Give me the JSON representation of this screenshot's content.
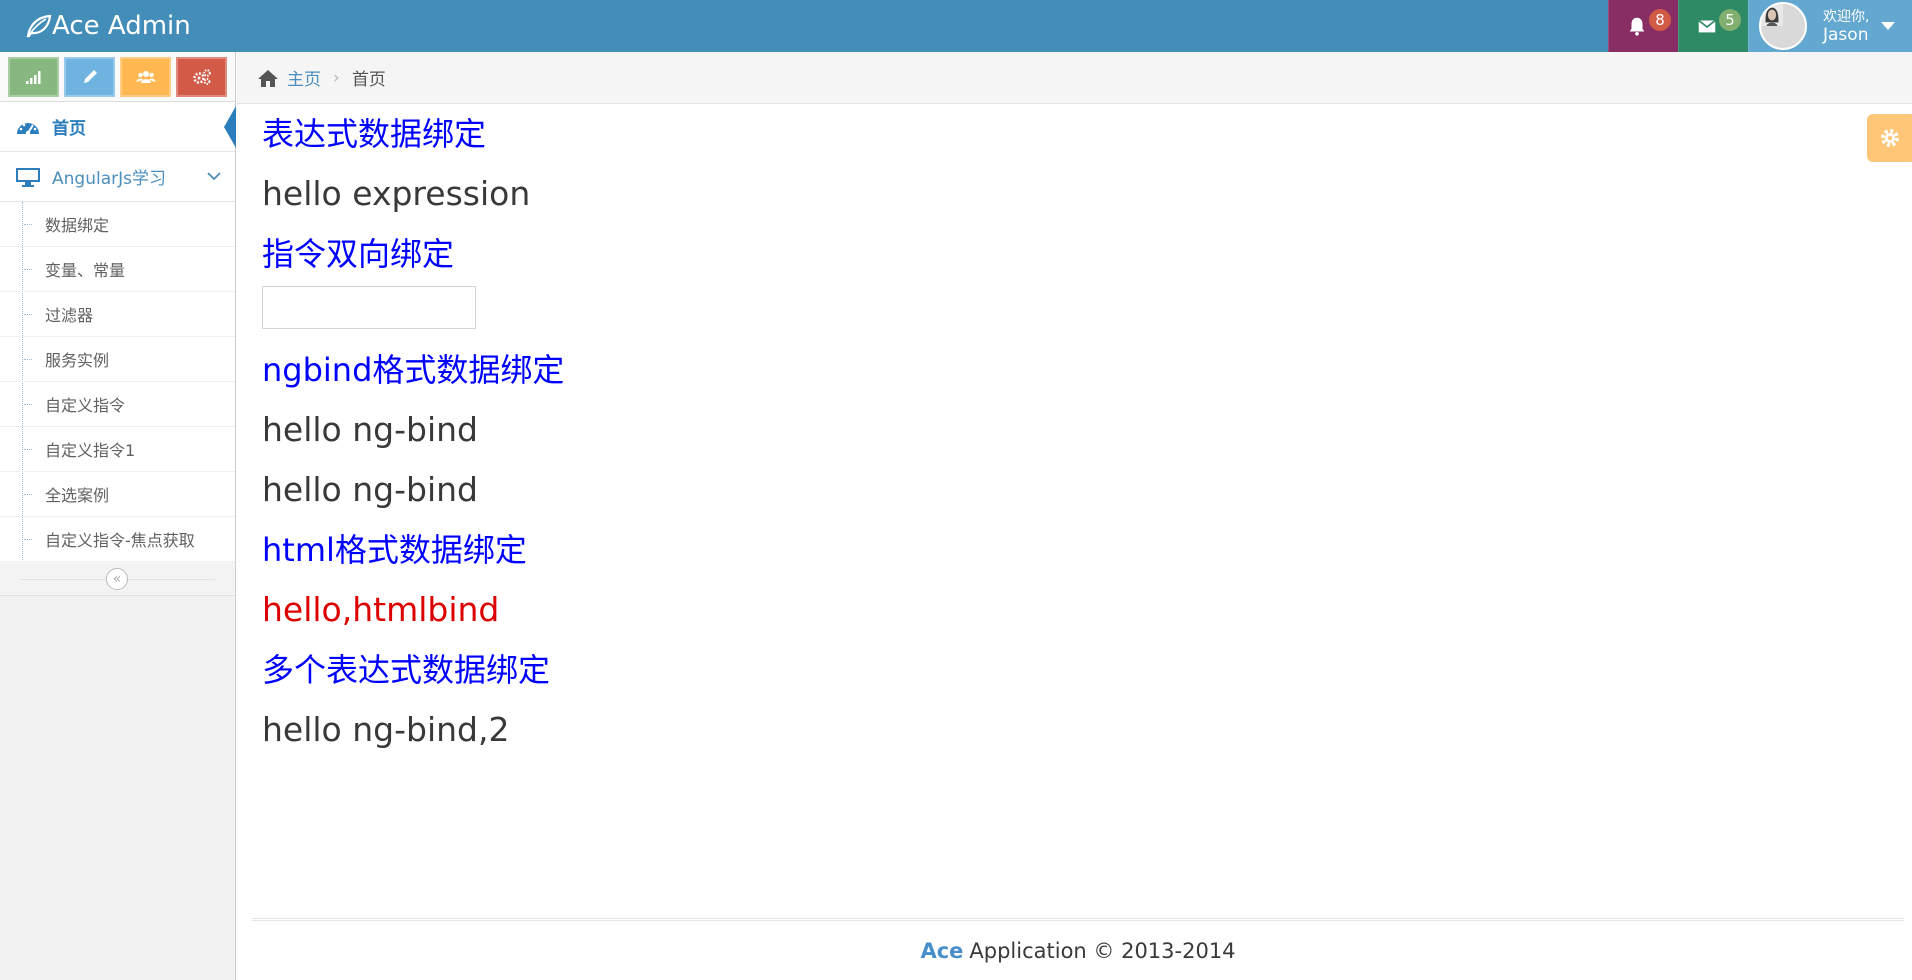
{
  "navbar": {
    "brand": "Ace Admin",
    "brand_icon": "leaf-icon",
    "notifications_count": "8",
    "messages_count": "5",
    "user": {
      "welcome": "欢迎你,",
      "name": "Jason"
    }
  },
  "sidebar": {
    "shortcuts": [
      {
        "icon": "signal-icon",
        "color": "#87b87f"
      },
      {
        "icon": "pencil-icon",
        "color": "#6fb3e0"
      },
      {
        "icon": "group-icon",
        "color": "#ffb752"
      },
      {
        "icon": "cogs-icon",
        "color": "#d15b47"
      }
    ],
    "items": [
      {
        "label": "首页",
        "icon": "dashboard-icon",
        "active": true
      },
      {
        "label": "AngularJs学习",
        "icon": "desktop-icon",
        "open": true
      }
    ],
    "subitems": [
      "数据绑定",
      "变量、常量",
      "过滤器",
      "服务实例",
      "自定义指令",
      "自定义指令1",
      "全选案例",
      "自定义指令-焦点获取"
    ]
  },
  "breadcrumbs": {
    "home": "主页",
    "current": "首页"
  },
  "content": {
    "h1": "表达式数据绑定",
    "t1": "hello expression",
    "h2": "指令双向绑定",
    "input_value": "",
    "h3": "ngbind格式数据绑定",
    "t2": "hello ng-bind",
    "t3": "hello ng-bind",
    "h4": "html格式数据绑定",
    "t4": "hello,htmlbind",
    "h5": "多个表达式数据绑定",
    "t5": "hello ng-bind,2"
  },
  "footer": {
    "brand": "Ace",
    "text": "Application © 2013-2014"
  },
  "colors": {
    "navbar": "#438eb9",
    "link_blue": "#0000ff",
    "html_red": "#dd0000"
  }
}
